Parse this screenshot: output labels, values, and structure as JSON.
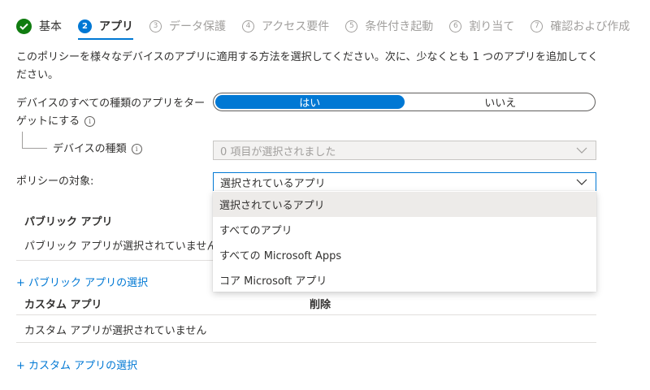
{
  "steps": [
    {
      "label": "基本",
      "status": "done"
    },
    {
      "number": "2",
      "label": "アプリ",
      "status": "active"
    },
    {
      "number": "3",
      "label": "データ保護",
      "status": "pending"
    },
    {
      "number": "4",
      "label": "アクセス要件",
      "status": "pending"
    },
    {
      "number": "5",
      "label": "条件付き起動",
      "status": "pending"
    },
    {
      "number": "6",
      "label": "割り当て",
      "status": "pending"
    },
    {
      "number": "7",
      "label": "確認および作成",
      "status": "pending"
    }
  ],
  "description": "このポリシーを様々なデバイスのアプリに適用する方法を選択してください。次に、少なくとも 1 つのアプリを追加してください。",
  "target_all": {
    "label_line1": "デバイスのすべての種類のアプリをター",
    "label_line2": "ゲットにする",
    "yes": "はい",
    "no": "いいえ",
    "selected": "はい"
  },
  "device_types": {
    "label": "デバイスの種類",
    "value": "0 項目が選択されました"
  },
  "policy_target": {
    "label": "ポリシーの対象:",
    "value": "選択されているアプリ",
    "options": [
      "選択されているアプリ",
      "すべてのアプリ",
      "すべての Microsoft Apps",
      "コア Microsoft アプリ"
    ]
  },
  "public_apps": {
    "header": "パブリック アプリ",
    "empty": "パブリック アプリが選択されていません",
    "select_link": "+ パブリック アプリの選択"
  },
  "custom_apps": {
    "header": "カスタム アプリ",
    "delete_header": "削除",
    "empty": "カスタム アプリが選択されていません",
    "select_link": "+ カスタム アプリの選択"
  },
  "colors": {
    "accent": "#0078d4",
    "done": "#107c10",
    "text": "#323130",
    "muted": "#a19f9d"
  },
  "icons": {
    "done_step": "checkmark-icon",
    "info": "info-icon",
    "dropdown": "chevron-down-icon"
  }
}
